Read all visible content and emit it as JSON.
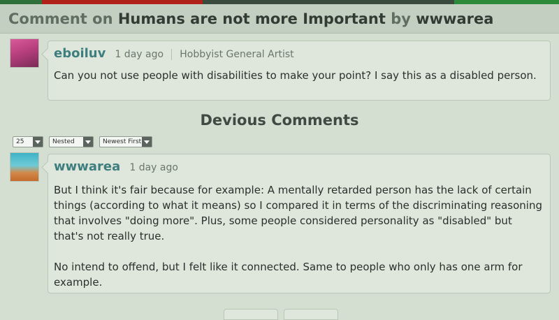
{
  "header": {
    "prefix": "Comment on",
    "title": "Humans are not more Important",
    "by": "by",
    "author": "wwwarea"
  },
  "parent_comment": {
    "username": "eboiluv",
    "time": "1 day ago",
    "role": "Hobbyist General Artist",
    "text": "Can you not use people with disabilities to make your point?  I say this as a disabled person."
  },
  "section": {
    "title": "Devious Comments"
  },
  "controls": {
    "per_page": "25",
    "view_mode": "Nested",
    "sort": "Newest First"
  },
  "reply": {
    "username": "wwwarea",
    "time": "1 day ago",
    "paragraphs": [
      "But I think it's fair because for example: A mentally retarded person has the lack of certain things (according to what it means) so I compared it in terms of the discriminating reasoning that involves \"doing more\". Plus, some people considered personality as \"disabled\" but that's not really true.",
      "No intend to offend, but I felt like it connected. Same to people who only has one arm for example."
    ]
  }
}
